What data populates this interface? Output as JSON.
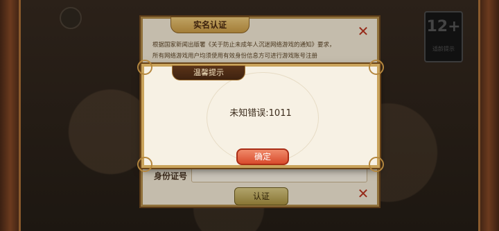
{
  "background": {
    "age_badge_number": "12+",
    "age_badge_text": "适龄提示"
  },
  "realname_panel": {
    "title": "实名认证",
    "notice_line1": "根据国家新闻出版署《关于防止未成年人沉迷网络游戏的通知》要求，",
    "notice_line2": "所有网络游戏用户均须使用有效身份信息方可进行游戏账号注册",
    "id_label": "身份证号",
    "verify_button": "认证",
    "close_icon": "close-x-icon"
  },
  "tip_dialog": {
    "title": "温馨提示",
    "message": "未知错误:1011",
    "ok_button": "确定"
  },
  "colors": {
    "close_red": "#b7321e",
    "ok_button": "#d84b2c",
    "frame_gold": "#caa45c"
  }
}
